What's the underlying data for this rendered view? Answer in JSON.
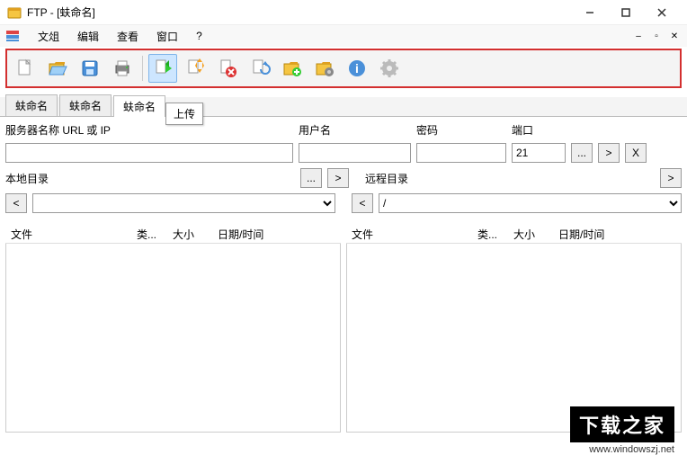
{
  "window": {
    "title": "FTP - [蚨命名]"
  },
  "menu": {
    "file": "文俎",
    "edit": "编辑",
    "view": "查看",
    "window": "窗口",
    "help": "?"
  },
  "tooltip": "上传",
  "tabs": [
    "蚨命名",
    "蚨命名",
    "蚨命名"
  ],
  "conn": {
    "server_label": "服务器名称 URL 或 IP",
    "user_label": "用户名",
    "pass_label": "密码",
    "port_label": "端口",
    "port_value": "21",
    "browse": "...",
    "go": ">",
    "close": "X"
  },
  "localdir_label": "本地目录",
  "remotedir_label": "远程目录",
  "remotedir_value": "/",
  "nav_back": "<",
  "columns": {
    "file": "文件",
    "type": "类...",
    "size": "大小",
    "date": "日期/时间"
  },
  "watermark": {
    "cn": "下载之家",
    "url": "www.windowszj.net"
  }
}
